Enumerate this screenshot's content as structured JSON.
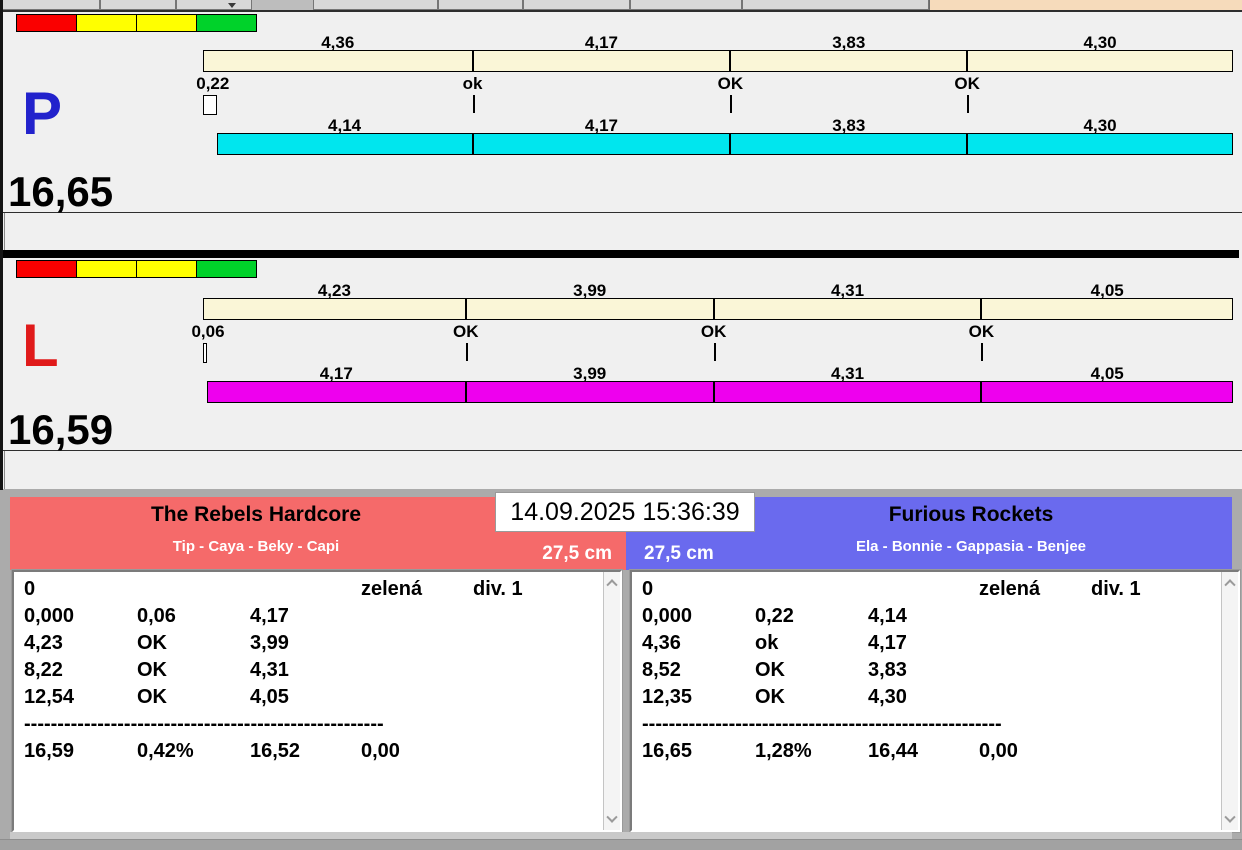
{
  "datetime": "14.09.2025 15:36:39",
  "lanes": [
    {
      "letter": "P",
      "letter_color": "#2222CC",
      "total": "16,65",
      "start_offset": "0,22",
      "split_labels": [
        "4,36",
        "4,17",
        "3,83",
        "4,30"
      ],
      "pass_labels": [
        "ok",
        "OK",
        "OK"
      ],
      "net_labels": [
        "4,14",
        "4,17",
        "3,83",
        "4,30"
      ],
      "split_bar_color": "#FAF6D7",
      "net_bar_color": "#00E6EE",
      "status_colors": [
        "#FA0000",
        "#FFFF00",
        "#FFFF00",
        "#00D22A"
      ]
    },
    {
      "letter": "L",
      "letter_color": "#E01A1A",
      "total": "16,59",
      "start_offset": "0,06",
      "split_labels": [
        "4,23",
        "3,99",
        "4,31",
        "4,05"
      ],
      "pass_labels": [
        "OK",
        "OK",
        "OK"
      ],
      "net_labels": [
        "4,17",
        "3,99",
        "4,31",
        "4,05"
      ],
      "split_bar_color": "#FAF6D7",
      "net_bar_color": "#EE00EE",
      "status_colors": [
        "#FA0000",
        "#FFFF00",
        "#FFFF00",
        "#00D22A"
      ]
    }
  ],
  "teams": [
    {
      "name": "The Rebels Hardcore",
      "dogs": "Tip - Caya - Beky - Capi",
      "height": "27,5 cm",
      "color": "#F56A6A",
      "log_rows": [
        [
          "0",
          "",
          "",
          "zelená",
          "div. 1"
        ],
        [
          "0,000",
          "0,06",
          "4,17",
          "",
          ""
        ],
        [
          "4,23",
          "OK",
          "3,99",
          "",
          ""
        ],
        [
          "8,22",
          "OK",
          "4,31",
          "",
          ""
        ],
        [
          "12,54",
          "OK",
          "4,05",
          "",
          ""
        ],
        [
          "------------------------------------------------------",
          "",
          "",
          "",
          ""
        ],
        [
          "16,59",
          "0,42%",
          "16,52",
          "0,00",
          ""
        ]
      ]
    },
    {
      "name": "Furious Rockets",
      "dogs": "Ela - Bonnie - Gappasia - Benjee",
      "height": "27,5 cm",
      "color": "#6A6AEE",
      "log_rows": [
        [
          "0",
          "",
          "",
          "zelená",
          "div. 1"
        ],
        [
          "0,000",
          "0,22",
          "4,14",
          "",
          ""
        ],
        [
          "4,36",
          "ok",
          "4,17",
          "",
          ""
        ],
        [
          "8,52",
          "OK",
          "3,83",
          "",
          ""
        ],
        [
          "12,35",
          "OK",
          "4,30",
          "",
          ""
        ],
        [
          "------------------------------------------------------",
          "",
          "",
          "",
          ""
        ],
        [
          "16,65",
          "1,28%",
          "16,44",
          "0,00",
          ""
        ]
      ]
    }
  ]
}
